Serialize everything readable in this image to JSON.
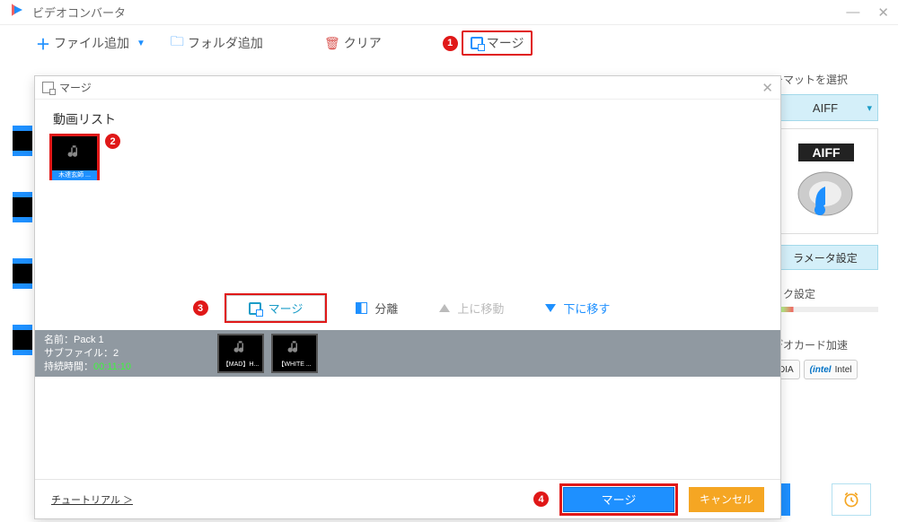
{
  "app": {
    "title": "ビデオコンバータ"
  },
  "toolbar": {
    "add_file": "ファイル追加",
    "add_folder": "フォルダ追加",
    "clear": "クリア",
    "merge": "マージ"
  },
  "badges": {
    "b1": "1",
    "b2": "2",
    "b3": "3",
    "b4": "4"
  },
  "right": {
    "format_label": "ーマットを選択",
    "format_value": "AIFF",
    "preview_text": "AIFF",
    "param_btn": "ラメータ設定",
    "quick_set": "ック設定",
    "video_accel": "デオカード加速",
    "chip1": "DIA",
    "chip2_brand": "intel",
    "chip2_text": "Intel"
  },
  "modal": {
    "title": "マージ",
    "video_list_label": "動画リスト",
    "video_thumb_label": "木達玄師 ...",
    "actions": {
      "merge": "マージ",
      "separate": "分離",
      "move_up": "上に移動",
      "move_down": "下に移す"
    },
    "pack": {
      "name_label": "名前：",
      "name_value": "Pack 1",
      "subfile_label": "サブファイル：",
      "subfile_value": "2",
      "duration_label": "持続時間：",
      "duration_value": "00:11:10",
      "items": [
        {
          "label": "【MAD】H..."
        },
        {
          "label": "【WHITE ..."
        }
      ]
    },
    "tutorial": "チュートリアル ＞",
    "btn_merge": "マージ",
    "btn_cancel": "キャンセル"
  }
}
